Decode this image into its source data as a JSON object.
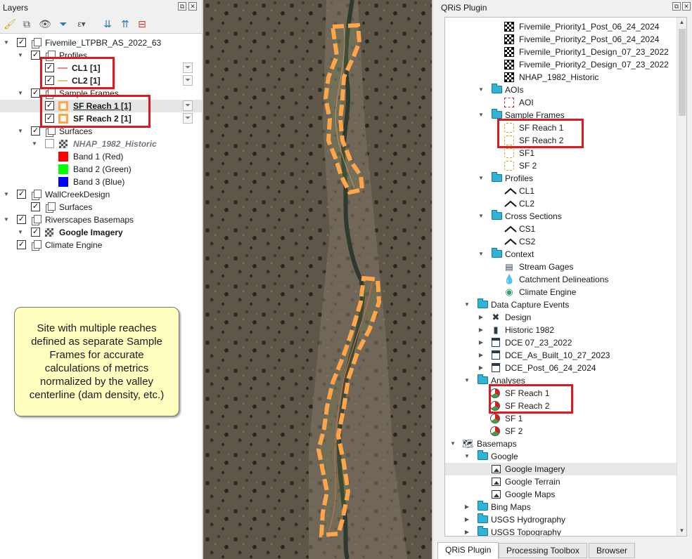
{
  "layers_panel": {
    "title": "Layers",
    "toolbar": [
      "open-layer-styling-icon",
      "add-group-icon",
      "manage-map-themes-icon",
      "filter-legend-icon",
      "filter-by-expression-icon",
      "expand-all-icon",
      "collapse-all-icon",
      "remove-layer-icon"
    ],
    "tree": {
      "project": "Fivemile_LTPBR_AS_2022_63",
      "profiles_group": "Profiles",
      "cl1": "CL1 [1]",
      "cl2": "CL2 [1]",
      "sample_frames_group": "Sample Frames",
      "sf_reach_1": "SF Reach 1 [1]",
      "sf_reach_2": "SF Reach 2 [1]",
      "surfaces_group": "Surfaces",
      "nhap": "NHAP_1982_Historic",
      "band1": "Band 1 (Red)",
      "band2": "Band 2 (Green)",
      "band3": "Band 3 (Blue)",
      "wallcreek": "WallCreekDesign",
      "wallcreek_surfaces": "Surfaces",
      "riverscapes": "Riverscapes Basemaps",
      "google_imagery": "Google Imagery",
      "climate_engine": "Climate Engine"
    },
    "colors": {
      "band1": "#ff0000",
      "band2": "#00ff00",
      "band3": "#0000ff",
      "cl1": "#e88a8a",
      "cl2": "#e0c870",
      "sample_frame": "#ffa54a",
      "highlight": "#e4181c"
    }
  },
  "callout": {
    "text": "Site with multiple reaches defined as separate Sample Frames for accurate calculations of metrics normalized by the valley centerline (dam density, etc.)"
  },
  "qris_panel": {
    "title": "QRiS Plugin",
    "items": {
      "surf1": "Fivemile_Priority1_Post_06_24_2024",
      "surf2": "Fivemile_Priority2_Post_06_24_2024",
      "surf3": "Fivemile_Priority1_Design_07_23_2022",
      "surf4": "Fivemile_Priority2_Design_07_23_2022",
      "surf5": "NHAP_1982_Historic",
      "aois": "AOIs",
      "aoi": "AOI",
      "sample_frames": "Sample Frames",
      "sf_reach_1": "SF Reach 1",
      "sf_reach_2": "SF Reach 2",
      "sf1": "SF1",
      "sf2": "SF 2",
      "profiles": "Profiles",
      "cl1": "CL1",
      "cl2": "CL2",
      "cross_sections": "Cross Sections",
      "cs1": "CS1",
      "cs2": "CS2",
      "context": "Context",
      "stream_gages": "Stream Gages",
      "catchment": "Catchment Delineations",
      "climate_engine": "Climate Engine",
      "dce": "Data Capture Events",
      "design": "Design",
      "historic": "Historic 1982",
      "dce1": "DCE 07_23_2022",
      "dce2": "DCE_As_Built_10_27_2023",
      "dce3": "DCE_Post_06_24_2024",
      "analyses": "Analyses",
      "a_sf_reach_1": "SF Reach 1",
      "a_sf_reach_2": "SF Reach 2",
      "a_sf1": "SF 1",
      "a_sf2": "SF 2",
      "basemaps": "Basemaps",
      "google": "Google",
      "google_imagery": "Google Imagery",
      "google_terrain": "Google Terrain",
      "google_maps": "Google Maps",
      "bing": "Bing Maps",
      "usgs_hydro": "USGS Hydrography",
      "usgs_topo": "USGS Topography"
    },
    "tabs": [
      "QRiS Plugin",
      "Processing Toolbox",
      "Browser"
    ],
    "active_tab": "QRiS Plugin"
  },
  "map": {
    "background": "#5a5447",
    "reach_outline_color": "#ffa54a"
  }
}
